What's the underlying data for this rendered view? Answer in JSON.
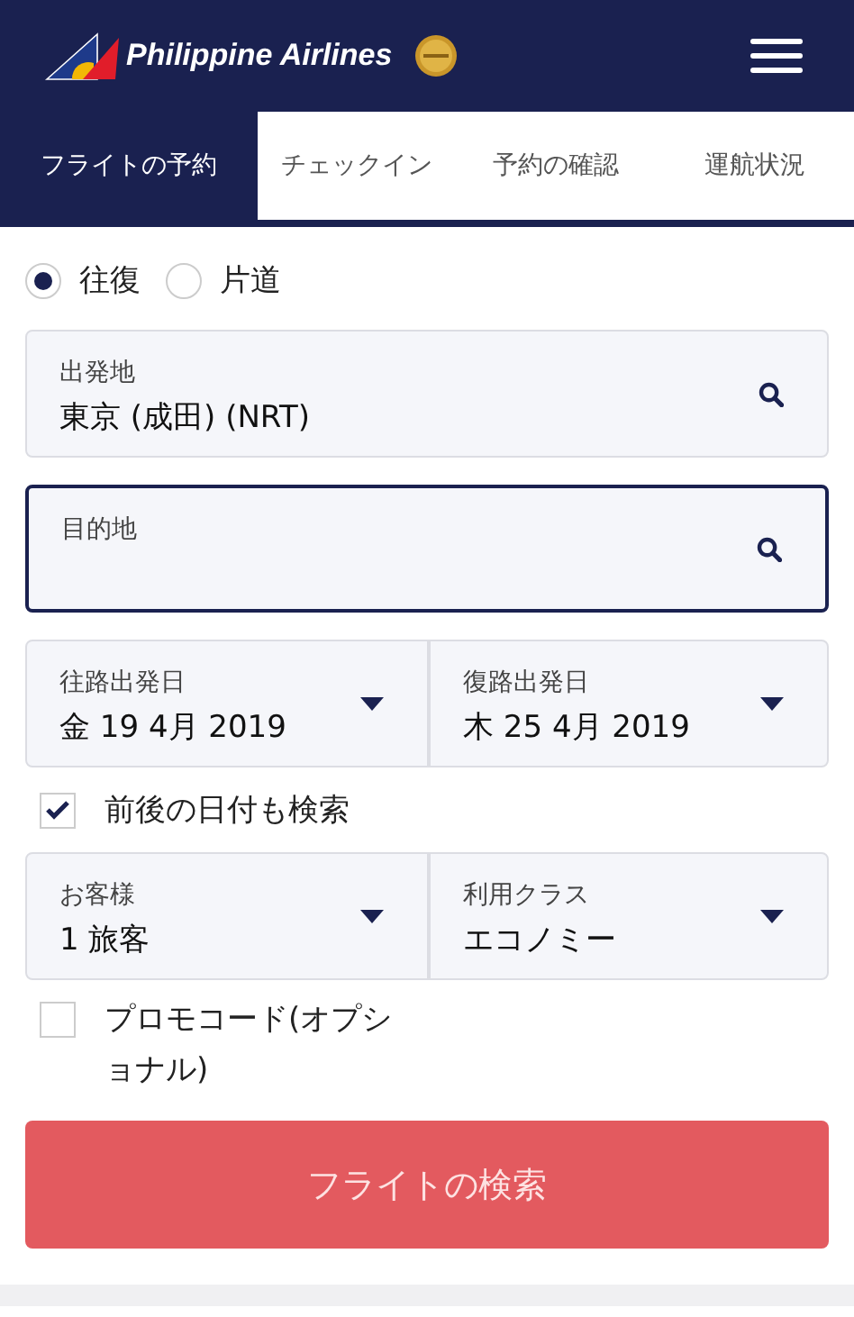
{
  "header": {
    "brand": "Philippine Airlines"
  },
  "tabs": [
    {
      "label": "フライトの予約",
      "selected": true
    },
    {
      "label": "チェックイン",
      "selected": false
    },
    {
      "label": "予約の確認",
      "selected": false
    },
    {
      "label": "運航状況",
      "selected": false
    }
  ],
  "trip_types": [
    {
      "label": "往復",
      "selected": true
    },
    {
      "label": "片道",
      "selected": false
    }
  ],
  "airports": [
    {
      "label": "出発地",
      "value": "東京 (成田) (NRT)",
      "focused": false
    },
    {
      "label": "目的地",
      "focused": true
    }
  ],
  "dates": [
    {
      "label": "往路出発日",
      "value": "金 19 4月 2019"
    },
    {
      "label": "復路出発日",
      "value": "木 25 4月 2019"
    }
  ],
  "flexible_dates": {
    "label": "前後の日付も検索",
    "checked": true
  },
  "travel": [
    {
      "label": "お客様",
      "value": "1 旅客"
    },
    {
      "label": "利用クラス",
      "value": "エコノミー"
    }
  ],
  "promo_code": {
    "label": "プロモコード(オプショナル)",
    "checked": false
  },
  "search_button": {
    "label": "フライトの検索"
  }
}
